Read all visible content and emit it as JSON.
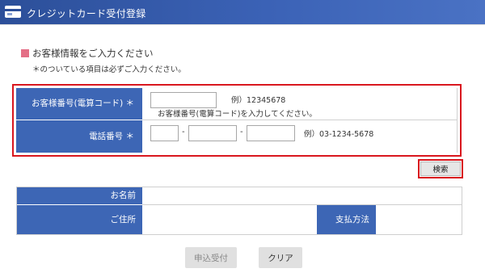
{
  "header": {
    "title": "クレジットカード受付登録",
    "icon": "credit-card-icon"
  },
  "section": {
    "title": "お客様情報をご入力ください",
    "note": "＊のついている項目は必ずご入力ください。",
    "marker_color": "#e46f86"
  },
  "form": {
    "customer_number": {
      "label": "お客様番号(電算コード) ＊",
      "value": "",
      "example": "例）12345678",
      "hint": "お客様番号(電算コード)を入力してください。"
    },
    "phone": {
      "label": "電話番号 ＊",
      "part1": "",
      "part2": "",
      "part3": "",
      "separator": "-",
      "example": "例）03-1234-5678"
    },
    "search_label": "検索"
  },
  "info": {
    "name_label": "お名前",
    "name_value": "",
    "address_label": "ご住所",
    "address_value": "",
    "payment_label": "支払方法",
    "payment_value": ""
  },
  "actions": {
    "apply_label": "申込受付",
    "apply_state": "disabled",
    "clear_label": "クリア"
  },
  "colors": {
    "header_blue": "#2c4f99",
    "label_blue": "#3d66b5",
    "highlight_red": "#d9171e"
  }
}
